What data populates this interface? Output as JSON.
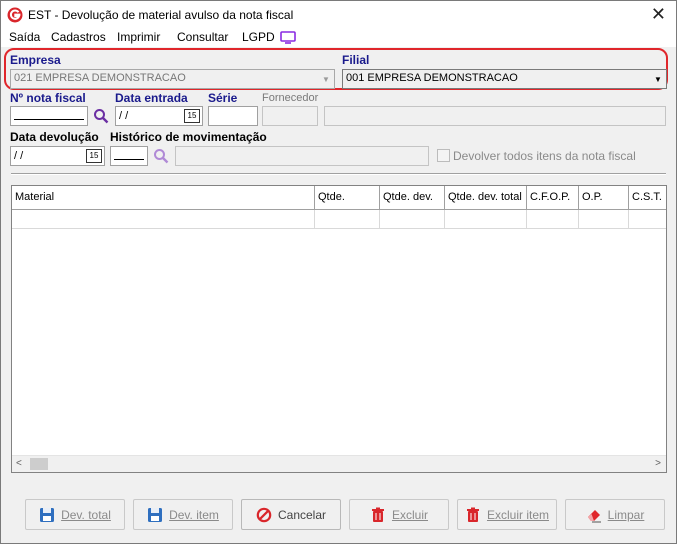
{
  "window": {
    "title": "EST - Devolução de material avulso da nota fiscal"
  },
  "menu": {
    "items": [
      "Saída",
      "Cadastros",
      "Imprimir",
      "Consultar",
      "LGPD"
    ]
  },
  "form": {
    "empresa_label": "Empresa",
    "empresa_value": "021 EMPRESA DEMONSTRACAO",
    "filial_label": "Filial",
    "filial_value": "001 EMPRESA DEMONSTRACAO",
    "nota_label": "Nº nota fiscal",
    "data_entrada_label": "Data entrada",
    "data_entrada_value": " / /",
    "serie_label": "Série",
    "fornecedor_label": "Fornecedor",
    "data_devolucao_label": "Data devolução",
    "data_devolucao_value": " / /",
    "historico_label": "Histórico de movimentação",
    "devolver_todos_label": "Devolver todos itens da nota fiscal"
  },
  "grid": {
    "columns": [
      "Material",
      "Qtde.",
      "Qtde. dev.",
      "Qtde. dev. total",
      "C.F.O.P.",
      "O.P.",
      "C.S.T."
    ]
  },
  "buttons": {
    "dev_total": "Dev. total",
    "dev_item": "Dev. item",
    "cancelar": "Cancelar",
    "excluir": "Excluir",
    "excluir_item": "Excluir item",
    "limpar": "Limpar"
  },
  "colors": {
    "highlight": "#e0262b",
    "label_blue": "#1a1a8c",
    "search_purple": "#6b2fa3"
  }
}
